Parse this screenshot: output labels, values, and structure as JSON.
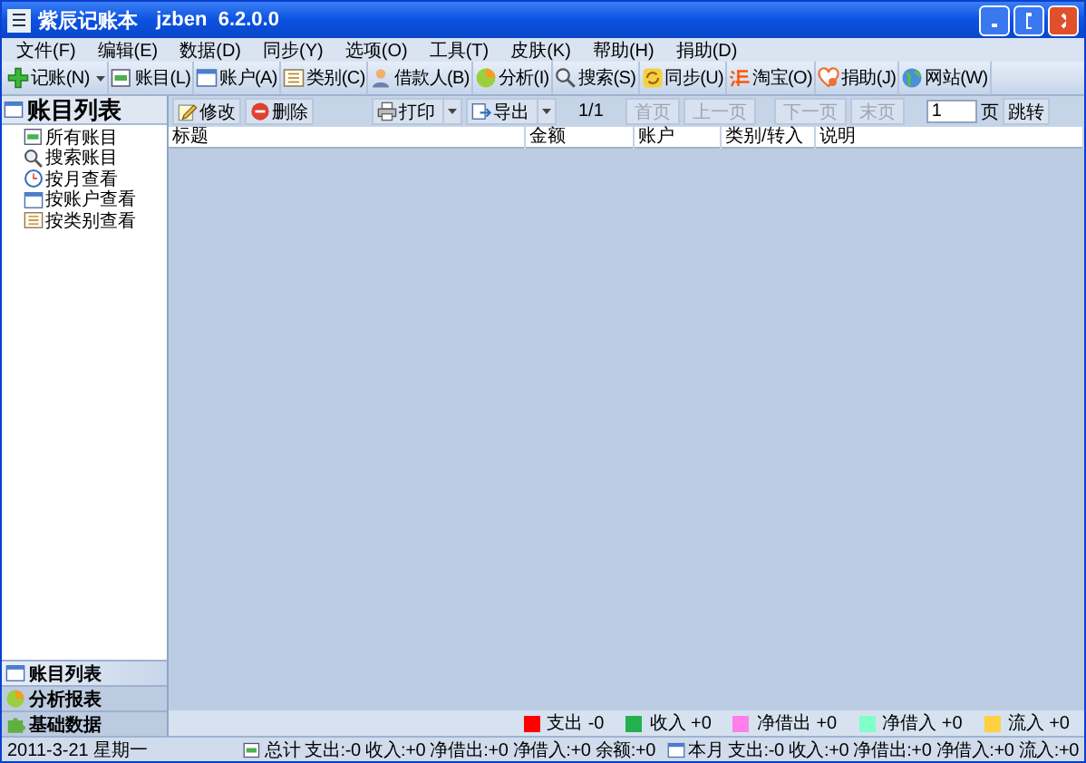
{
  "window": {
    "title": "紫辰记账本",
    "version": "jzben  6.2.0.0"
  },
  "menu": [
    "文件(F)",
    "编辑(E)",
    "数据(D)",
    "同步(Y)",
    "选项(O)",
    "工具(T)",
    "皮肤(K)",
    "帮助(H)",
    "捐助(D)"
  ],
  "toolbar": [
    {
      "label": "记账(N)",
      "dropdown": true
    },
    {
      "label": "账目(L)",
      "dropdown": false
    },
    {
      "label": "账户(A)",
      "dropdown": false
    },
    {
      "label": "类别(C)",
      "dropdown": false
    },
    {
      "label": "借款人(B)",
      "dropdown": false
    },
    {
      "label": "分析(I)",
      "dropdown": false
    },
    {
      "label": "搜索(S)",
      "dropdown": false
    },
    {
      "label": "同步(U)",
      "dropdown": false
    },
    {
      "label": "淘宝(O)",
      "dropdown": false
    },
    {
      "label": "捐助(J)",
      "dropdown": false
    },
    {
      "label": "网站(W)",
      "dropdown": false
    }
  ],
  "sidebar": {
    "title": "账目列表",
    "items": [
      {
        "label": "所有账目"
      },
      {
        "label": "搜索账目"
      },
      {
        "label": "按月查看"
      },
      {
        "label": "按账户查看"
      },
      {
        "label": "按类别查看"
      }
    ],
    "tabs": [
      {
        "label": "账目列表",
        "selected": true
      },
      {
        "label": "分析报表",
        "selected": false
      },
      {
        "label": "基础数据",
        "selected": false
      }
    ]
  },
  "actions": [
    {
      "label": "修改",
      "dropdown": false
    },
    {
      "label": "删除",
      "dropdown": false
    },
    {
      "label": "打印",
      "dropdown": true
    },
    {
      "label": "导出",
      "dropdown": true
    }
  ],
  "pager": {
    "position": "1/1",
    "buttons": [
      {
        "label": "首页",
        "disabled": true
      },
      {
        "label": "上一页",
        "disabled": true
      },
      {
        "label": "下一页",
        "disabled": true
      },
      {
        "label": "末页",
        "disabled": true
      }
    ],
    "page_value": "1",
    "page_unit": "页",
    "jump": "跳转"
  },
  "table": {
    "columns": [
      "标题",
      "金额",
      "账户",
      "类别/转入",
      "说明"
    ]
  },
  "legend": [
    {
      "label": "支出",
      "value": "-0",
      "color": "#ff0000"
    },
    {
      "label": "收入",
      "value": "+0",
      "color": "#22b14c"
    },
    {
      "label": "净借出",
      "value": "+0",
      "color": "#ff80e8"
    },
    {
      "label": "净借入",
      "value": "+0",
      "color": "#80ffc8"
    },
    {
      "label": "流入",
      "value": "+0",
      "color": "#ffd040"
    }
  ],
  "status_bar": {
    "date": "2011-3-21 星期一",
    "summaries": [
      {
        "label": "总计",
        "text": "支出:-0 收入:+0 净借出:+0 净借入:+0 余额:+0"
      },
      {
        "label": "本月",
        "text": "支出:-0 收入:+0 净借出:+0 净借入:+0 流入:+0"
      }
    ]
  }
}
